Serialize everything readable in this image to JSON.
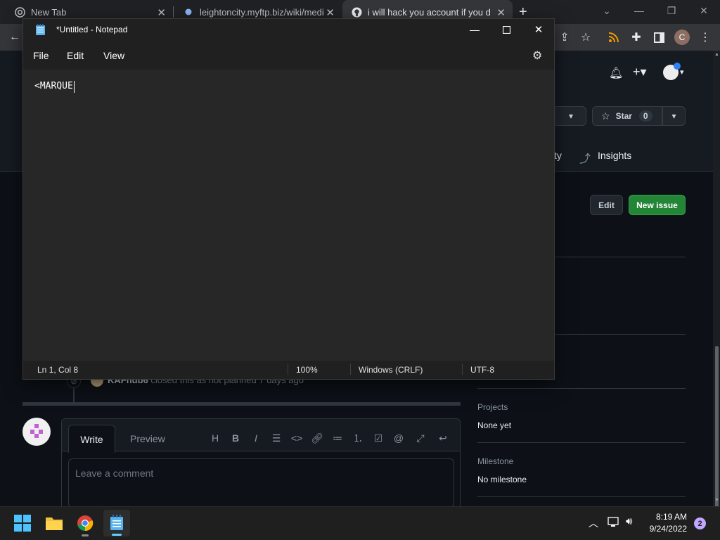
{
  "browser": {
    "tabs": [
      {
        "label": "New Tab"
      },
      {
        "label": "leightoncity.myftp.biz/wiki/medi"
      },
      {
        "label": "i will hack you account if you dor"
      }
    ],
    "profile_initial": "C"
  },
  "github": {
    "star_label": "Star",
    "star_count": "0",
    "nav_partial": "ty",
    "nav_insights": "Insights",
    "edit_button": "Edit",
    "new_issue_button": "New issue",
    "timeline_user": "KAFhub6",
    "timeline_text": "closed this as not planned",
    "timeline_time": "7 days ago",
    "sidebar": {
      "projects_label": "Projects",
      "projects_value": "None yet",
      "milestone_label": "Milestone",
      "milestone_value": "No milestone"
    },
    "comment": {
      "write_tab": "Write",
      "preview_tab": "Preview",
      "placeholder": "Leave a comment",
      "heading_tool": "H"
    }
  },
  "notepad": {
    "title": "*Untitled - Notepad",
    "menu": [
      "File",
      "Edit",
      "View"
    ],
    "content": "<MARQUE",
    "status": {
      "position": "Ln 1, Col 8",
      "zoom": "100%",
      "line_ending": "Windows (CRLF)",
      "encoding": "UTF-8"
    }
  },
  "taskbar": {
    "time": "8:19 AM",
    "date": "9/24/2022",
    "notification_count": "2"
  },
  "colors": {
    "github_bg": "#0d1117",
    "notepad_bg": "#272727",
    "accent_green": "#238636"
  }
}
